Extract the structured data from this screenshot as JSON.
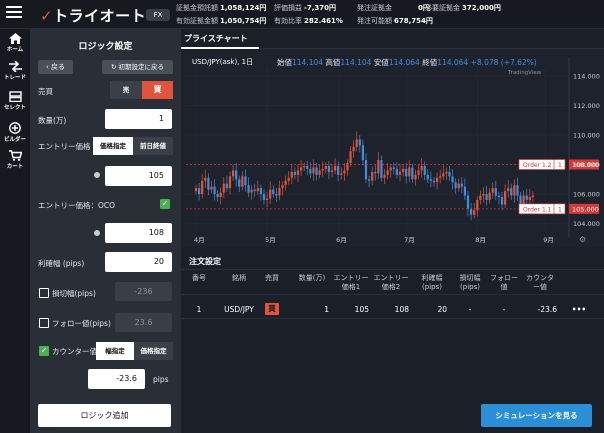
{
  "app": {
    "logo_text": "トライオート",
    "mode_badge": "FX"
  },
  "header_stats": [
    {
      "label": "証拠金預託額",
      "value": "1,058,124円"
    },
    {
      "label": "評価損益",
      "value": "-7,370円"
    },
    {
      "label": "発注証拠金",
      "value": "0円"
    },
    {
      "label": "必要証拠金",
      "value": "372,000円"
    },
    {
      "label": "有効証拠金額",
      "value": "1,050,754円"
    },
    {
      "label": "有効比率",
      "value": "282.461%"
    },
    {
      "label": "発注可能額",
      "value": "678,754円"
    }
  ],
  "nav": {
    "home": "ホーム",
    "trade": "トレード",
    "select": "セレクト",
    "builder": "ビルダー",
    "cart": "カート"
  },
  "logic": {
    "title": "ロジック設定",
    "back": "戻る",
    "reset": "初期設定に戻る",
    "side_label": "売買",
    "sell": "売",
    "buy": "買",
    "qty_label": "数量(万)",
    "qty_value": "1",
    "entry_label": "エントリー価格",
    "price_specified": "価格指定",
    "prev_close": "前日終値",
    "entry_value": "105",
    "oco_label": "エントリー価格：OCO",
    "oco_value": "108",
    "tp_label": "利確幅 (pips)",
    "tp_value": "20",
    "sl_label": "損切幅(pips)",
    "sl_value": "-236",
    "follow_label": "フォロー値(pips)",
    "follow_value": "23.6",
    "counter_label": "カウンター値",
    "width_specified": "幅指定",
    "counter_price": "価格指定",
    "counter_value": "-23.6",
    "counter_unit": "pips",
    "add_button": "ロジック追加"
  },
  "chart_tab": "プライスチャート",
  "chart_data": {
    "type": "candlestick",
    "symbol": "USD/JPY(ask), 1日",
    "ohlc_labels": {
      "open_label": "始値",
      "open": "114.104",
      "high_label": "高値",
      "high": "114.104",
      "low_label": "安値",
      "low": "114.064",
      "close_label": "終値",
      "close": "114.064",
      "change": "+8.078 (+7.62%)"
    },
    "watermark": "TradingView",
    "y_ticks": [
      "114.000",
      "112.000",
      "110.000",
      "108.000",
      "106.000",
      "104.000"
    ],
    "ylim": [
      103.5,
      114.6
    ],
    "x_ticks": [
      "4月",
      "5月",
      "6月",
      "7月",
      "8月",
      "9月"
    ],
    "x_tick_index": [
      0,
      23,
      46,
      68,
      91,
      113
    ],
    "order_lines": [
      {
        "name": "Order 1.2",
        "qty": "1",
        "price": 108.0,
        "label": "108.000"
      },
      {
        "name": "Order 1.1",
        "qty": "1",
        "price": 105.0,
        "label": "105.000"
      }
    ],
    "closes": [
      106.4,
      106.0,
      106.9,
      107.1,
      106.3,
      106.5,
      106.0,
      105.8,
      106.1,
      106.7,
      106.4,
      107.2,
      107.6,
      107.0,
      106.5,
      107.2,
      106.6,
      106.1,
      106.3,
      106.2,
      106.4,
      106.0,
      105.6,
      105.7,
      106.3,
      106.0,
      105.9,
      106.4,
      106.6,
      106.9,
      107.1,
      107.5,
      107.3,
      107.6,
      107.8,
      107.9,
      107.7,
      107.4,
      107.8,
      107.3,
      107.6,
      107.7,
      107.9,
      107.5,
      107.6,
      107.9,
      107.3,
      107.4,
      107.6,
      108.1,
      108.9,
      109.2,
      109.7,
      109.3,
      108.3,
      107.0,
      106.9,
      107.5,
      107.4,
      108.3,
      107.1,
      107.3,
      107.6,
      107.8,
      107.7,
      107.3,
      107.5,
      107.7,
      107.2,
      107.8,
      107.0,
      107.3,
      107.6,
      107.9,
      107.3,
      107.0,
      106.9,
      106.8,
      107.1,
      107.2,
      107.4,
      107.5,
      107.2,
      106.8,
      106.4,
      106.7,
      106.5,
      105.9,
      105.0,
      104.6,
      104.9,
      105.6,
      105.9,
      106.0,
      105.6,
      106.1,
      106.4,
      105.9,
      105.8,
      105.3,
      106.2,
      106.4,
      105.9,
      106.6,
      105.9,
      105.2,
      105.9,
      105.6,
      105.8,
      105.9
    ]
  },
  "orders": {
    "title": "注文設定",
    "columns": [
      "番号",
      "銘柄",
      "売買",
      "数量(万)",
      "エントリー価格1",
      "エントリー価格2",
      "利確幅(pips)",
      "損切幅(pips)",
      "フォロー値",
      "カウンター値"
    ],
    "rows": [
      {
        "no": "1",
        "symbol": "USD/JPY",
        "side": "買",
        "qty": "1",
        "entry1": "105",
        "entry2": "108",
        "tp": "20",
        "sl": "-",
        "follow": "-",
        "counter": "-23.6",
        "more": "•••"
      }
    ]
  },
  "simulate_button": "シミュレーションを見る",
  "colors": {
    "accent": "#e0553a",
    "buy": "#e0553a",
    "up_candle": "#e0553a",
    "down_candle": "#3d8fe0",
    "order_line": "#d43a3a",
    "sim_button": "#2a8fd6",
    "check": "#4caf50"
  }
}
